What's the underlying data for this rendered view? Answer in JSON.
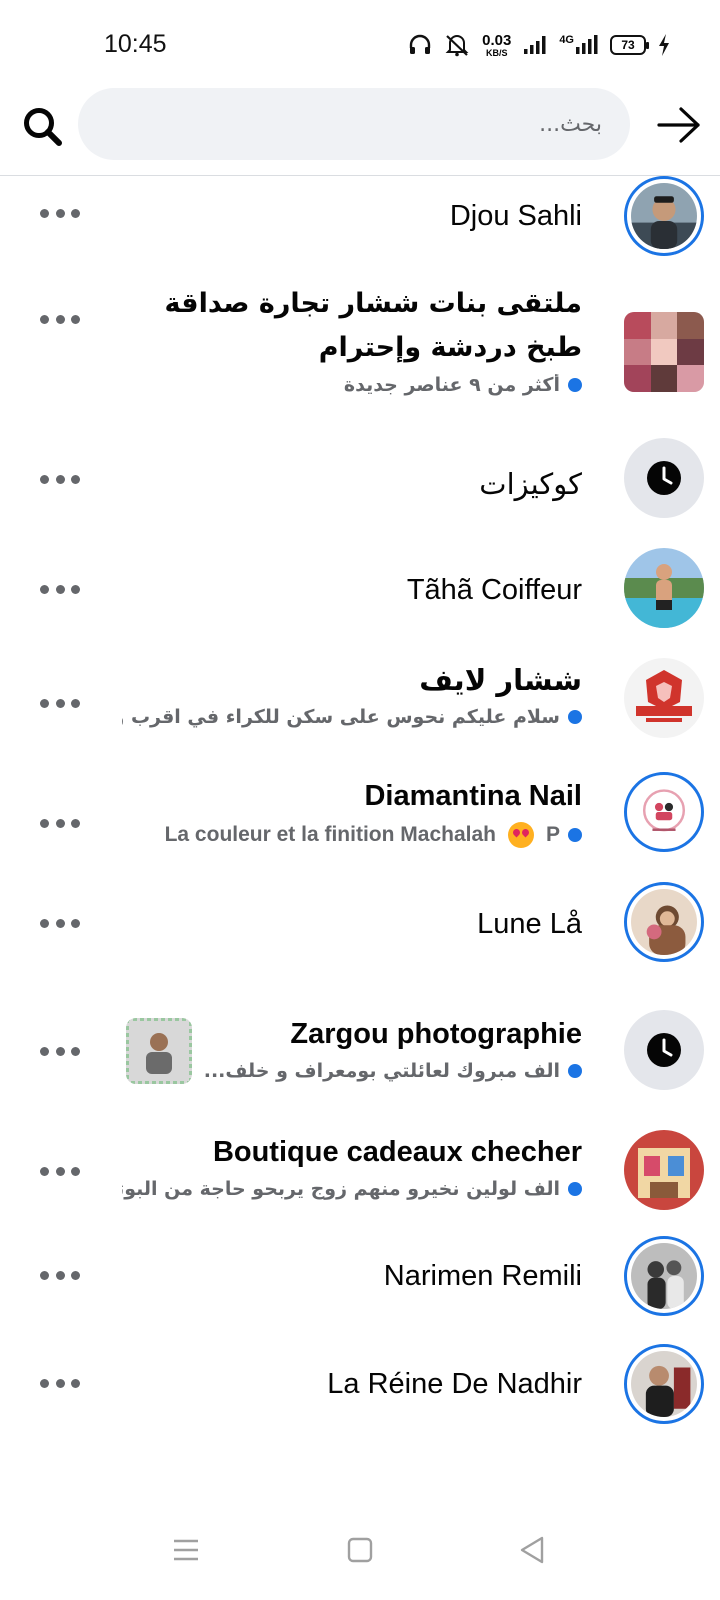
{
  "status_bar": {
    "time": "10:45",
    "net_speed_value": "0.03",
    "net_speed_unit": "KB/S",
    "network_type": "4G",
    "battery": "73",
    "icons": [
      "headphones-icon",
      "mute-icon",
      "signal-icon",
      "signal-4g-icon",
      "battery-icon",
      "charging-icon"
    ]
  },
  "search": {
    "placeholder": "بحث...",
    "value": ""
  },
  "colors": {
    "accent": "#1b74e4",
    "secondary_text": "#65676b",
    "search_bg": "#f0f2f5"
  },
  "results": [
    {
      "name": "Djou Sahli",
      "subtitle": "",
      "unread": false
    },
    {
      "name": "ملتقى بنات ششار تجارة صداقة طبخ دردشة وإحترام",
      "subtitle": "أكثر من ٩ عناصر جديدة",
      "unread": true
    },
    {
      "name": "كوكيزات",
      "subtitle": "",
      "unread": false
    },
    {
      "name": "Tãhã Coiffeur",
      "subtitle": "",
      "unread": false
    },
    {
      "name": "ششار لايف",
      "subtitle": "سلام عليكم نحوس على سكن للكراء في اقرب و.",
      "unread": true
    },
    {
      "name": "Diamantina Nail",
      "subtitle_prefix": "P",
      "subtitle": "La couleur et la finition Machalah",
      "unread": true
    },
    {
      "name": "Lune Lå",
      "subtitle": "",
      "unread": false
    },
    {
      "name": "Zargou photographie",
      "subtitle": "الف مبروك لعائلتي بومعراف و خلف...",
      "unread": true
    },
    {
      "name": "Boutique cadeaux checher",
      "subtitle": "الف لولين نخيرو منهم زوج يربحو حاجة من البوتيك",
      "unread": true
    },
    {
      "name": "Narimen Remili",
      "subtitle": "",
      "unread": false
    },
    {
      "name": "La Réine De Nadhir",
      "subtitle": "",
      "unread": false
    }
  ]
}
